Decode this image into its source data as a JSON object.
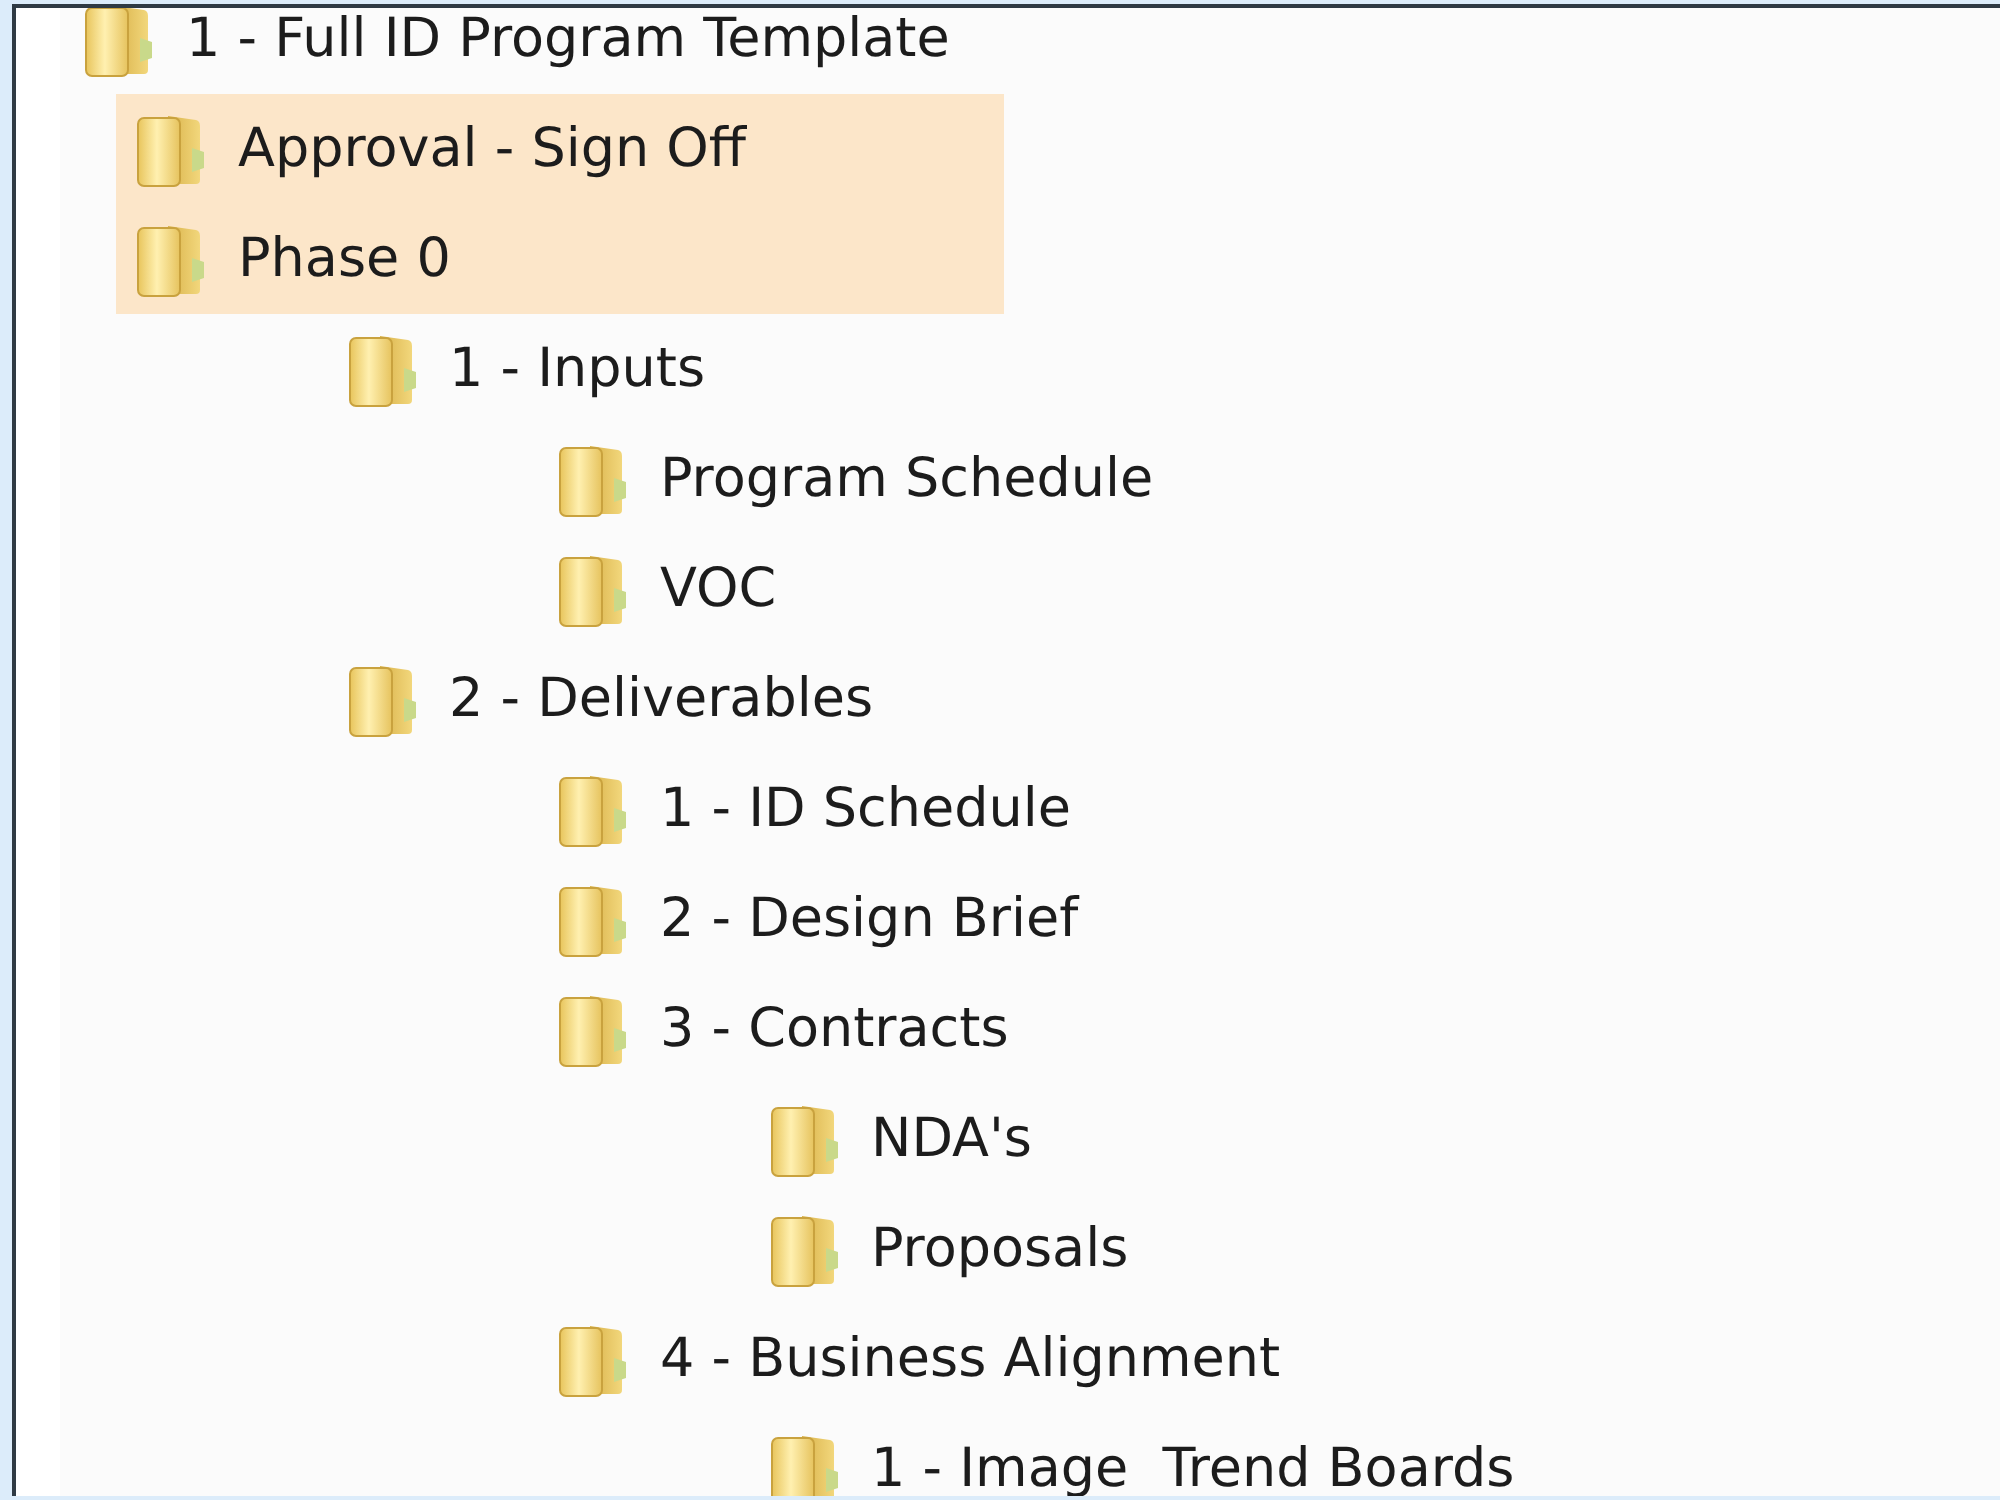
{
  "tree": {
    "items": [
      {
        "label": "1 - Full ID Program Template",
        "selected": false,
        "children": [
          {
            "label": "Approval - Sign Off",
            "selected": true
          },
          {
            "label": "Phase 0",
            "selected": true,
            "children": [
              {
                "label": "1 - Inputs",
                "selected": false,
                "children": [
                  {
                    "label": "Program Schedule",
                    "selected": false
                  },
                  {
                    "label": "VOC",
                    "selected": false
                  }
                ]
              },
              {
                "label": "2 - Deliverables",
                "selected": false,
                "children": [
                  {
                    "label": "1 - ID Schedule",
                    "selected": false
                  },
                  {
                    "label": "2 - Design Brief",
                    "selected": false
                  },
                  {
                    "label": "3 - Contracts",
                    "selected": false,
                    "children": [
                      {
                        "label": "NDA's",
                        "selected": false
                      },
                      {
                        "label": "Proposals",
                        "selected": false
                      }
                    ]
                  },
                  {
                    "label": "4 - Business Alignment",
                    "selected": false,
                    "children": [
                      {
                        "label": "1 - Image  Trend Boards",
                        "selected": false
                      }
                    ]
                  }
                ]
              }
            ]
          }
        ]
      }
    ]
  }
}
